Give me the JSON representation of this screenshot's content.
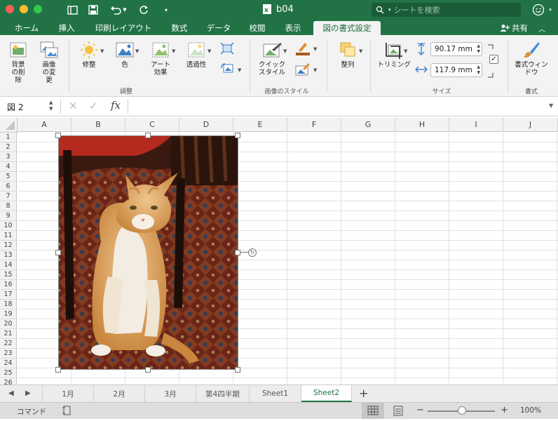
{
  "window": {
    "title": "b04"
  },
  "search": {
    "placeholder": "シートを検索"
  },
  "tabs": [
    "ホーム",
    "挿入",
    "印刷レイアウト",
    "数式",
    "データ",
    "校閲",
    "表示",
    "図の書式設定"
  ],
  "active_tab": "図の書式設定",
  "share_label": "共有",
  "ribbon": {
    "remove_bg": "背景の削除",
    "change_picture": "画像の変更",
    "corrections": "修整",
    "color": "色",
    "artistic": "アート効果",
    "transparency": "透過性",
    "quick_styles": "クイックスタイル",
    "arrange": "整列",
    "crop": "トリミング",
    "height": "90.17 mm",
    "width": "117.9 mm",
    "format_pane": "書式ウィンドウ",
    "group_adjust": "調整",
    "group_styles": "画像のスタイル",
    "group_size": "サイズ",
    "group_format": "書式"
  },
  "formula": {
    "name_box": "図 2",
    "fx": "fx",
    "content": ""
  },
  "columns": [
    "A",
    "B",
    "C",
    "D",
    "E",
    "F",
    "G",
    "H",
    "I",
    "J"
  ],
  "rows": [
    "1",
    "2",
    "3",
    "4",
    "5",
    "6",
    "7",
    "8",
    "9",
    "10",
    "11",
    "12",
    "13",
    "14",
    "15",
    "16",
    "17",
    "18",
    "19",
    "20",
    "21",
    "22",
    "23",
    "24",
    "25",
    "26"
  ],
  "sheets": [
    "1月",
    "2月",
    "3月",
    "第4四半期",
    "Sheet1",
    "Sheet2"
  ],
  "active_sheet": "Sheet2",
  "status": {
    "mode": "コマンド",
    "zoom": "100%"
  },
  "colors": {
    "accent": "#217346"
  }
}
